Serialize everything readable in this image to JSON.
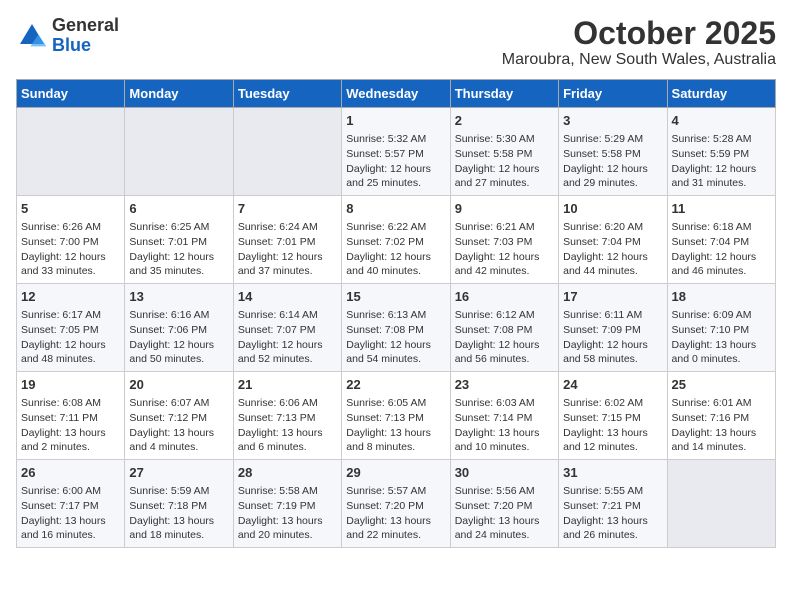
{
  "logo": {
    "general": "General",
    "blue": "Blue"
  },
  "title": "October 2025",
  "subtitle": "Maroubra, New South Wales, Australia",
  "headers": [
    "Sunday",
    "Monday",
    "Tuesday",
    "Wednesday",
    "Thursday",
    "Friday",
    "Saturday"
  ],
  "weeks": [
    [
      {
        "day": "",
        "info": ""
      },
      {
        "day": "",
        "info": ""
      },
      {
        "day": "",
        "info": ""
      },
      {
        "day": "1",
        "info": "Sunrise: 5:32 AM\nSunset: 5:57 PM\nDaylight: 12 hours\nand 25 minutes."
      },
      {
        "day": "2",
        "info": "Sunrise: 5:30 AM\nSunset: 5:58 PM\nDaylight: 12 hours\nand 27 minutes."
      },
      {
        "day": "3",
        "info": "Sunrise: 5:29 AM\nSunset: 5:58 PM\nDaylight: 12 hours\nand 29 minutes."
      },
      {
        "day": "4",
        "info": "Sunrise: 5:28 AM\nSunset: 5:59 PM\nDaylight: 12 hours\nand 31 minutes."
      }
    ],
    [
      {
        "day": "5",
        "info": "Sunrise: 6:26 AM\nSunset: 7:00 PM\nDaylight: 12 hours\nand 33 minutes."
      },
      {
        "day": "6",
        "info": "Sunrise: 6:25 AM\nSunset: 7:01 PM\nDaylight: 12 hours\nand 35 minutes."
      },
      {
        "day": "7",
        "info": "Sunrise: 6:24 AM\nSunset: 7:01 PM\nDaylight: 12 hours\nand 37 minutes."
      },
      {
        "day": "8",
        "info": "Sunrise: 6:22 AM\nSunset: 7:02 PM\nDaylight: 12 hours\nand 40 minutes."
      },
      {
        "day": "9",
        "info": "Sunrise: 6:21 AM\nSunset: 7:03 PM\nDaylight: 12 hours\nand 42 minutes."
      },
      {
        "day": "10",
        "info": "Sunrise: 6:20 AM\nSunset: 7:04 PM\nDaylight: 12 hours\nand 44 minutes."
      },
      {
        "day": "11",
        "info": "Sunrise: 6:18 AM\nSunset: 7:04 PM\nDaylight: 12 hours\nand 46 minutes."
      }
    ],
    [
      {
        "day": "12",
        "info": "Sunrise: 6:17 AM\nSunset: 7:05 PM\nDaylight: 12 hours\nand 48 minutes."
      },
      {
        "day": "13",
        "info": "Sunrise: 6:16 AM\nSunset: 7:06 PM\nDaylight: 12 hours\nand 50 minutes."
      },
      {
        "day": "14",
        "info": "Sunrise: 6:14 AM\nSunset: 7:07 PM\nDaylight: 12 hours\nand 52 minutes."
      },
      {
        "day": "15",
        "info": "Sunrise: 6:13 AM\nSunset: 7:08 PM\nDaylight: 12 hours\nand 54 minutes."
      },
      {
        "day": "16",
        "info": "Sunrise: 6:12 AM\nSunset: 7:08 PM\nDaylight: 12 hours\nand 56 minutes."
      },
      {
        "day": "17",
        "info": "Sunrise: 6:11 AM\nSunset: 7:09 PM\nDaylight: 12 hours\nand 58 minutes."
      },
      {
        "day": "18",
        "info": "Sunrise: 6:09 AM\nSunset: 7:10 PM\nDaylight: 13 hours\nand 0 minutes."
      }
    ],
    [
      {
        "day": "19",
        "info": "Sunrise: 6:08 AM\nSunset: 7:11 PM\nDaylight: 13 hours\nand 2 minutes."
      },
      {
        "day": "20",
        "info": "Sunrise: 6:07 AM\nSunset: 7:12 PM\nDaylight: 13 hours\nand 4 minutes."
      },
      {
        "day": "21",
        "info": "Sunrise: 6:06 AM\nSunset: 7:13 PM\nDaylight: 13 hours\nand 6 minutes."
      },
      {
        "day": "22",
        "info": "Sunrise: 6:05 AM\nSunset: 7:13 PM\nDaylight: 13 hours\nand 8 minutes."
      },
      {
        "day": "23",
        "info": "Sunrise: 6:03 AM\nSunset: 7:14 PM\nDaylight: 13 hours\nand 10 minutes."
      },
      {
        "day": "24",
        "info": "Sunrise: 6:02 AM\nSunset: 7:15 PM\nDaylight: 13 hours\nand 12 minutes."
      },
      {
        "day": "25",
        "info": "Sunrise: 6:01 AM\nSunset: 7:16 PM\nDaylight: 13 hours\nand 14 minutes."
      }
    ],
    [
      {
        "day": "26",
        "info": "Sunrise: 6:00 AM\nSunset: 7:17 PM\nDaylight: 13 hours\nand 16 minutes."
      },
      {
        "day": "27",
        "info": "Sunrise: 5:59 AM\nSunset: 7:18 PM\nDaylight: 13 hours\nand 18 minutes."
      },
      {
        "day": "28",
        "info": "Sunrise: 5:58 AM\nSunset: 7:19 PM\nDaylight: 13 hours\nand 20 minutes."
      },
      {
        "day": "29",
        "info": "Sunrise: 5:57 AM\nSunset: 7:20 PM\nDaylight: 13 hours\nand 22 minutes."
      },
      {
        "day": "30",
        "info": "Sunrise: 5:56 AM\nSunset: 7:20 PM\nDaylight: 13 hours\nand 24 minutes."
      },
      {
        "day": "31",
        "info": "Sunrise: 5:55 AM\nSunset: 7:21 PM\nDaylight: 13 hours\nand 26 minutes."
      },
      {
        "day": "",
        "info": ""
      }
    ]
  ]
}
